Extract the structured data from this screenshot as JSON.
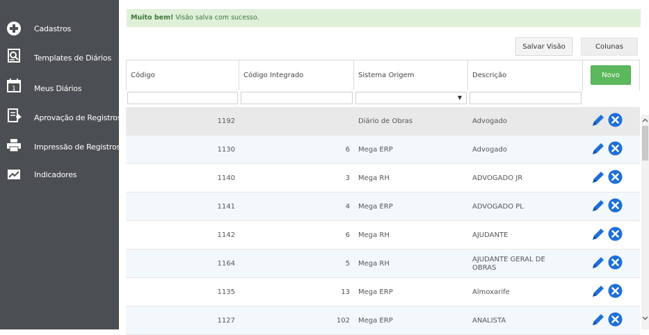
{
  "sidebar": {
    "items": [
      {
        "label": "Cadastros",
        "icon": "plus-circle-icon"
      },
      {
        "label": "Templates de Diários",
        "icon": "document-search-icon"
      },
      {
        "label": "Meus Diários",
        "icon": "calendar-icon"
      },
      {
        "label": "Aprovação de Registros",
        "icon": "approval-document-icon"
      },
      {
        "label": "Impressão de Registros",
        "icon": "printer-icon"
      },
      {
        "label": "Indicadores",
        "icon": "chart-icon"
      }
    ]
  },
  "alert": {
    "strong": "Muito bem!",
    "message": " Visão salva com sucesso."
  },
  "toolbar": {
    "save_view_label": "Salvar Visão",
    "columns_label": "Colunas"
  },
  "table": {
    "columns": [
      "Código",
      "Código Integrado",
      "Sistema Origem",
      "Descrição"
    ],
    "new_label": "Novo",
    "rows": [
      {
        "codigo": "1192",
        "integrado": "",
        "sistema": "Diário de Obras",
        "descricao": "Advogado"
      },
      {
        "codigo": "1130",
        "integrado": "6",
        "sistema": "Mega ERP",
        "descricao": "Advogado"
      },
      {
        "codigo": "1140",
        "integrado": "3",
        "sistema": "Mega RH",
        "descricao": "ADVOGADO JR"
      },
      {
        "codigo": "1141",
        "integrado": "4",
        "sistema": "Mega ERP",
        "descricao": "ADVOGADO PL"
      },
      {
        "codigo": "1142",
        "integrado": "6",
        "sistema": "Mega RH",
        "descricao": "AJUDANTE"
      },
      {
        "codigo": "1164",
        "integrado": "5",
        "sistema": "Mega RH",
        "descricao": "AJUDANTE GERAL DE OBRAS"
      },
      {
        "codigo": "1135",
        "integrado": "13",
        "sistema": "Mega ERP",
        "descricao": "Almoxarife"
      },
      {
        "codigo": "1127",
        "integrado": "102",
        "sistema": "Mega ERP",
        "descricao": "ANALISTA"
      }
    ]
  },
  "colors": {
    "sidebar_bg": "#4b4e52",
    "alert_bg": "#dff0d8",
    "alert_text": "#3c763d",
    "novo_bg": "#5cb85c",
    "edit_icon": "#1e6fd9",
    "delete_icon": "#1e6fd9",
    "row_selected": "#e9e9e9",
    "row_alt": "#f3f8fc"
  }
}
